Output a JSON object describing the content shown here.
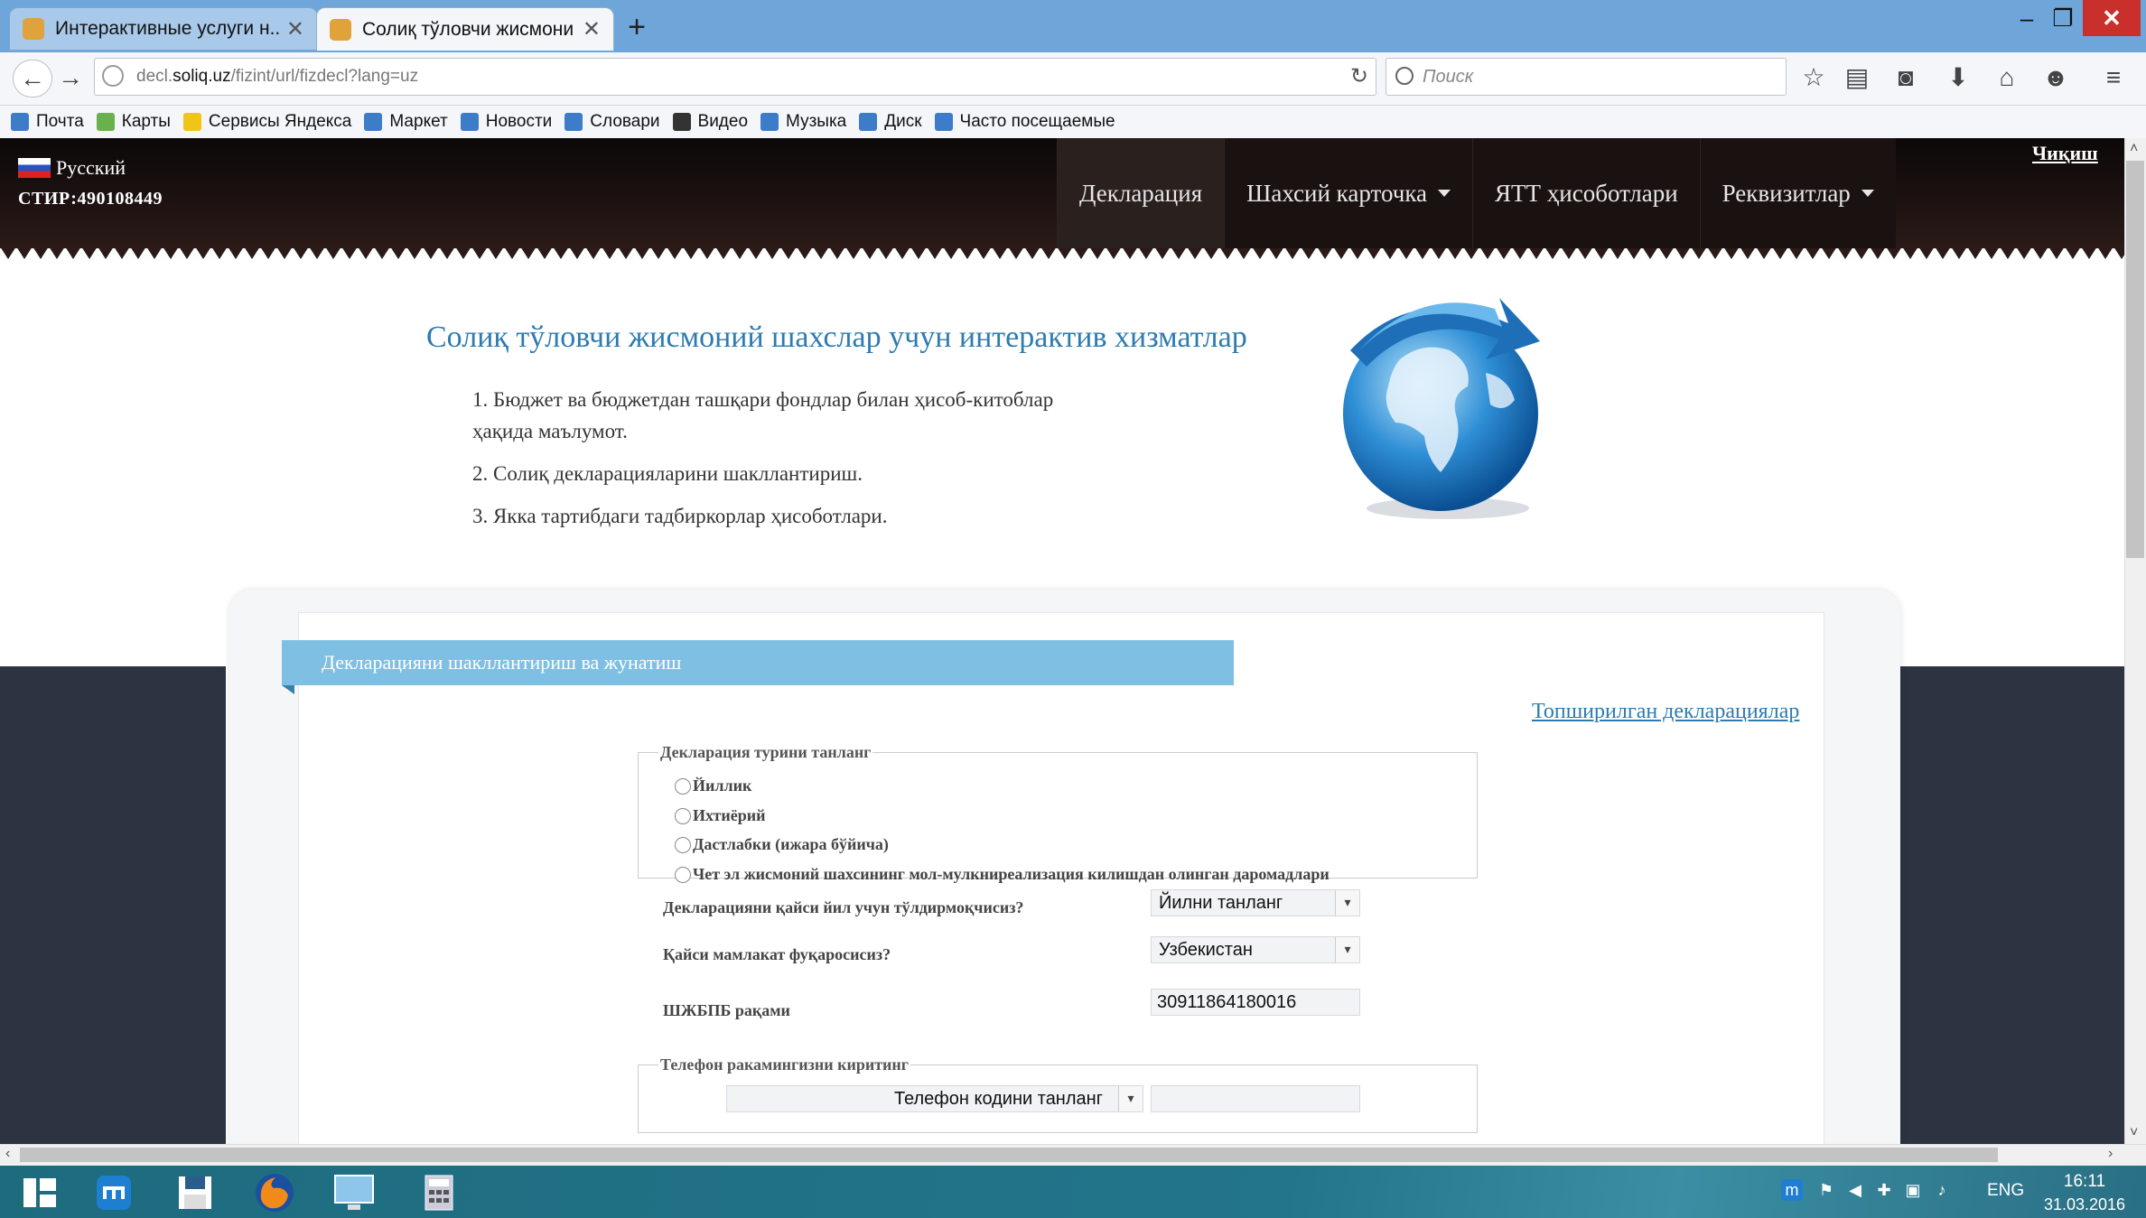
{
  "browser": {
    "tabs": [
      {
        "title": "Интерактивные услуги н...",
        "active": false
      },
      {
        "title": "Солиқ тўловчи жисмони...",
        "active": true
      }
    ],
    "url_prefix": "decl.",
    "url_domain": "soliq.uz",
    "url_path": "/fizint/url/fizdecl?lang=uz",
    "search_placeholder": "Поиск",
    "bookmarks": [
      "Почта",
      "Карты",
      "Сервисы Яндекса",
      "Маркет",
      "Новости",
      "Словари",
      "Видео",
      "Музыка",
      "Диск",
      "Часто посещаемые"
    ]
  },
  "header": {
    "language": "Русский",
    "stir": "СТИР:490108449",
    "logout": "Чиқиш",
    "menu": [
      {
        "label": "Декларация",
        "dropdown": false
      },
      {
        "label": "Шахсий карточка",
        "dropdown": true
      },
      {
        "label": "ЯТТ ҳисоботлари",
        "dropdown": false
      },
      {
        "label": "Реквизитлар",
        "dropdown": true
      }
    ]
  },
  "intro": {
    "title": "Солиқ тўловчи жисмоний шахслар учун интерактив хизматлар",
    "services": [
      "1. Бюджет ва бюджетдан ташқари фондлар билан ҳисоб-китоблар",
      "ҳақида маълумот.",
      "2. Солиқ декларацияларини шакллантириш.",
      "3. Якка тартибдаги тадбиркорлар ҳисоботлари."
    ]
  },
  "form": {
    "section_title": "Декларацияни шакллантириш ва жунатиш",
    "submitted_link": "Топширилган декларациялар",
    "type_legend": "Декларация турини танланг",
    "types": [
      "Йиллик",
      "Ихтиёрий",
      "Дастлабки (ижара бўйича)",
      "Чет эл жисмоний шахсининг мол-мулкниреализация килишдан олинган даромадлари"
    ],
    "year_label": "Декларацияни қайси йил учун тўлдирмоқчисиз?",
    "year_value": "Йилни танланг",
    "country_label": "Қайси мамлакат фуқаросисиз?",
    "country_value": "Узбекистан",
    "pinfl_label": "ШЖБПБ рақами",
    "pinfl_value": "30911864180016",
    "phone_legend": "Телефон ракамингизни киритинг",
    "phone_code_value": "Телефон кодини танланг",
    "phone_number_value": ""
  },
  "taskbar": {
    "lang": "ENG",
    "time": "16:11",
    "date": "31.03.2016"
  }
}
